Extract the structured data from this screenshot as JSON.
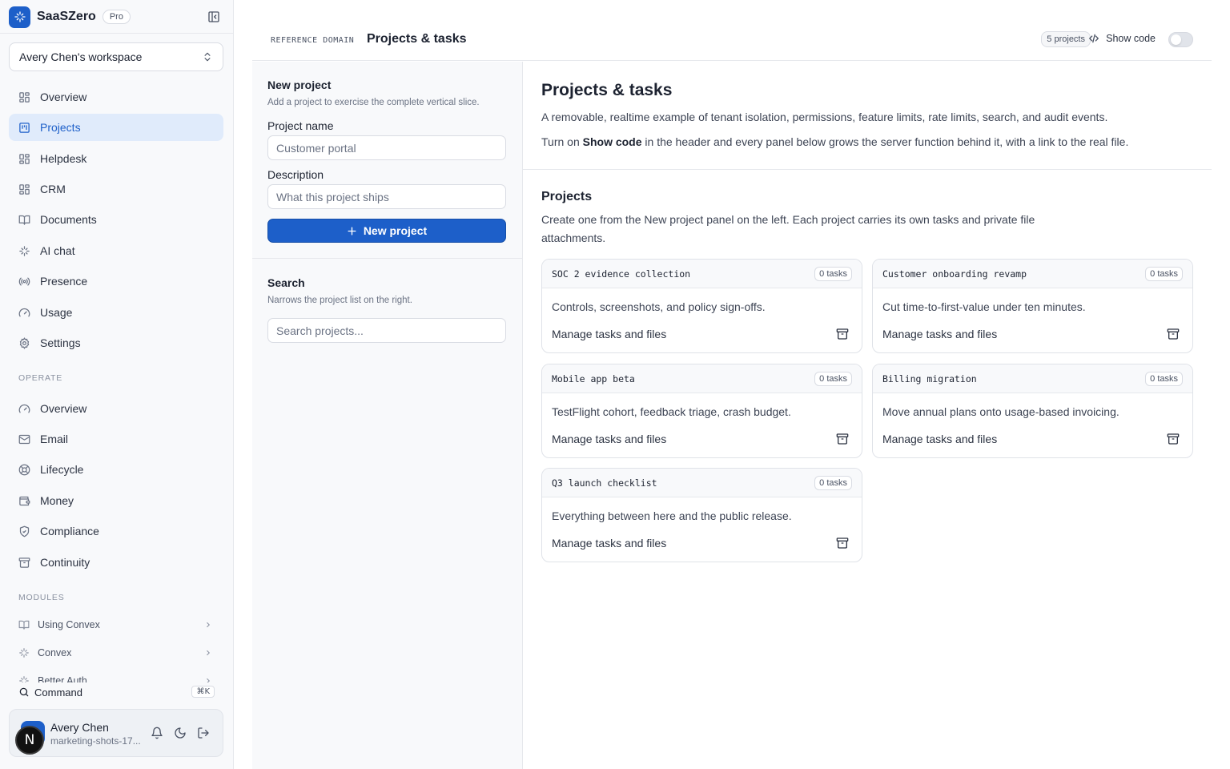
{
  "brand": {
    "name": "SaaSZero",
    "plan": "Pro"
  },
  "workspace": {
    "label": "Avery Chen's workspace"
  },
  "nav": [
    {
      "label": "Overview",
      "icon": "grid-icon"
    },
    {
      "label": "Projects",
      "icon": "kanban-icon",
      "active": true
    },
    {
      "label": "Helpdesk",
      "icon": "grid-icon"
    },
    {
      "label": "CRM",
      "icon": "grid-icon"
    },
    {
      "label": "Documents",
      "icon": "book-icon"
    },
    {
      "label": "AI chat",
      "icon": "sparkles-icon"
    },
    {
      "label": "Presence",
      "icon": "radio-icon"
    },
    {
      "label": "Usage",
      "icon": "gauge-icon"
    },
    {
      "label": "Settings",
      "icon": "gear-icon"
    }
  ],
  "operate": {
    "label": "OPERATE",
    "items": [
      {
        "label": "Overview",
        "icon": "gauge-icon"
      },
      {
        "label": "Email",
        "icon": "mail-icon"
      },
      {
        "label": "Lifecycle",
        "icon": "lifebuoy-icon"
      },
      {
        "label": "Money",
        "icon": "wallet-icon"
      },
      {
        "label": "Compliance",
        "icon": "shield-icon"
      },
      {
        "label": "Continuity",
        "icon": "archive-icon"
      }
    ]
  },
  "modules": {
    "label": "MODULES",
    "items": [
      {
        "label": "Using Convex",
        "icon": "book-icon"
      },
      {
        "label": "Convex",
        "icon": "sparkles-icon"
      },
      {
        "label": "Better Auth",
        "icon": "sparkles-icon"
      }
    ]
  },
  "command": {
    "label": "Command",
    "shortcut": "⌘K"
  },
  "user": {
    "initial": "N",
    "name": "Avery Chen",
    "sub": "marketing-shots-17..."
  },
  "header": {
    "domain": "REFERENCE DOMAIN",
    "title": "Projects & tasks",
    "count": "5 projects",
    "show_code": "Show code"
  },
  "form": {
    "title": "New project",
    "subtitle": "Add a project to exercise the complete vertical slice.",
    "name_label": "Project name",
    "name_placeholder": "Customer portal",
    "desc_label": "Description",
    "desc_placeholder": "What this project ships",
    "submit": "New project",
    "search_title": "Search",
    "search_subtitle": "Narrows the project list on the right.",
    "search_placeholder": "Search projects..."
  },
  "main": {
    "title": "Projects & tasks",
    "description": "A removable, realtime example of tenant isolation, permissions, feature limits, rate limits, search, and audit events.",
    "hint_prefix": "Turn on ",
    "hint_bold": "Show code",
    "hint_suffix": " in the header and every panel below grows the server function behind it, with a link to the real file.",
    "projects_title": "Projects",
    "projects_desc": "Create one from the New project panel on the left. Each project carries its own tasks and private file attachments."
  },
  "projects": [
    {
      "name": "SOC 2 evidence collection",
      "tasks": "0 tasks",
      "description": "Controls, screenshots, and policy sign-offs.",
      "link": "Manage tasks and files"
    },
    {
      "name": "Customer onboarding revamp",
      "tasks": "0 tasks",
      "description": "Cut time-to-first-value under ten minutes.",
      "link": "Manage tasks and files"
    },
    {
      "name": "Mobile app beta",
      "tasks": "0 tasks",
      "description": "TestFlight cohort, feedback triage, crash budget.",
      "link": "Manage tasks and files"
    },
    {
      "name": "Billing migration",
      "tasks": "0 tasks",
      "description": "Move annual plans onto usage-based invoicing.",
      "link": "Manage tasks and files"
    },
    {
      "name": "Q3 launch checklist",
      "tasks": "0 tasks",
      "description": "Everything between here and the public release.",
      "link": "Manage tasks and files"
    }
  ],
  "colors": {
    "accent": "#1d5fc9",
    "active_bg": "#e0ebfb",
    "border": "#e6e8ec"
  }
}
